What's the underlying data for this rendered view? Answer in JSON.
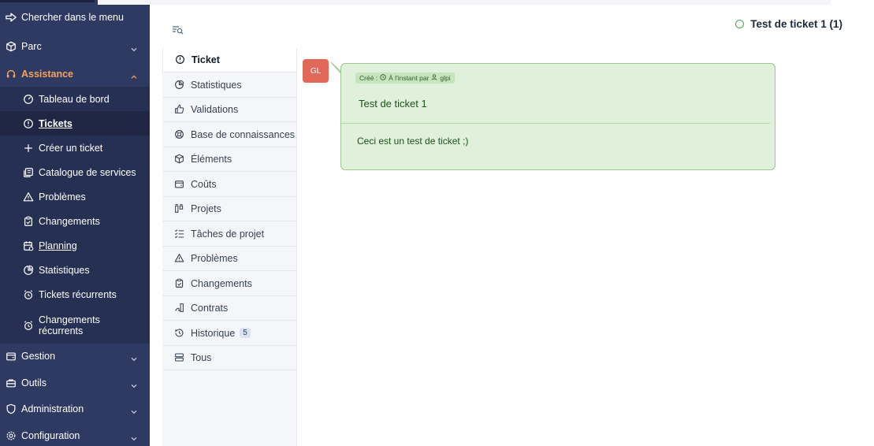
{
  "sidebar": {
    "search_label": "Chercher dans le menu",
    "sections": [
      {
        "label": "Parc",
        "icon": "box-icon"
      },
      {
        "label": "Assistance",
        "icon": "headset-icon"
      },
      {
        "label": "Gestion",
        "icon": "wallet-icon"
      },
      {
        "label": "Outils",
        "icon": "briefcase-icon"
      },
      {
        "label": "Administration",
        "icon": "shield-icon"
      },
      {
        "label": "Configuration",
        "icon": "gear-icon"
      }
    ],
    "assistance_items": [
      {
        "label": "Tableau de bord",
        "icon": "gauge-icon"
      },
      {
        "label": "Tickets",
        "icon": "alert-circle-icon",
        "active": true
      },
      {
        "label": "Créer un ticket",
        "icon": "plus-icon"
      },
      {
        "label": "Catalogue de services",
        "icon": "catalog-icon"
      },
      {
        "label": "Problèmes",
        "icon": "warning-icon"
      },
      {
        "label": "Changements",
        "icon": "clipboard-icon"
      },
      {
        "label": "Planning",
        "icon": "calendar-icon"
      },
      {
        "label": "Statistiques",
        "icon": "chart-pie-icon"
      },
      {
        "label": "Tickets récurrents",
        "icon": "alarm-icon"
      },
      {
        "label_line1": "Changements",
        "label_line2": "récurrents",
        "icon": "alarm-icon"
      }
    ]
  },
  "header": {
    "title": "Test de ticket 1 (1)"
  },
  "tabs": [
    {
      "label": "Ticket",
      "icon": "alert-circle-icon",
      "active": true
    },
    {
      "label": "Statistiques",
      "icon": "chart-pie-icon"
    },
    {
      "label": "Validations",
      "icon": "thumb-up-icon"
    },
    {
      "label": "Base de connaissances",
      "icon": "lifebuoy-icon"
    },
    {
      "label": "Éléments",
      "icon": "box-icon"
    },
    {
      "label": "Coûts",
      "icon": "wallet-icon"
    },
    {
      "label": "Projets",
      "icon": "projects-icon"
    },
    {
      "label": "Tâches de projet",
      "icon": "list-check-icon"
    },
    {
      "label": "Problèmes",
      "icon": "warning-icon"
    },
    {
      "label": "Changements",
      "icon": "clipboard-icon"
    },
    {
      "label": "Contrats",
      "icon": "contract-icon"
    },
    {
      "label": "Historique",
      "icon": "history-icon",
      "badge": "5"
    },
    {
      "label": "Tous",
      "icon": "server-icon"
    }
  ],
  "timeline": {
    "avatar_initials": "GL",
    "meta_created": "Créé :",
    "meta_time": "À l'instant par",
    "meta_user": "glpi",
    "title": "Test de ticket 1",
    "body": "Ceci est un test de ticket ;)"
  },
  "colors": {
    "sidebar_bg": "#2f3a63",
    "assistance_accent": "#f5a25a",
    "bubble_bg": "#dff1da",
    "avatar_bg": "#e0695a",
    "status_green": "#49a949"
  }
}
